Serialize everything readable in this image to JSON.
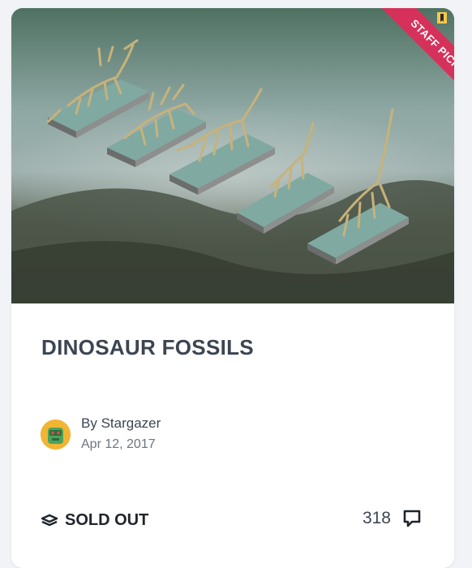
{
  "card": {
    "ribbon_label": "STAFF PICK",
    "title": "DINOSAUR FOSSILS",
    "author_prefix": "By",
    "author_name": "Stargazer",
    "date": "Apr 12, 2017",
    "status_label": "SOLD OUT",
    "comment_count": "318"
  },
  "icons": {
    "ribbon": "bookmark-flag-icon",
    "status": "layers-icon",
    "comments": "speech-bubble-icon"
  },
  "colors": {
    "ribbon": "#d6315a",
    "title": "#3c4552",
    "avatar_bg": "#f1b533",
    "background": "#f1f3f6"
  }
}
